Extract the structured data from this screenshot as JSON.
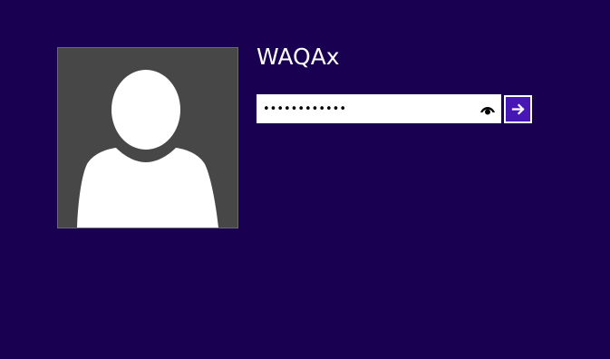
{
  "colors": {
    "background": "#1a0050",
    "avatar_tile_background": "#474747",
    "avatar_silhouette": "#ffffff",
    "username_text": "#ffffff",
    "password_field_background": "#ffffff",
    "submit_button_background": "#4617b4",
    "submit_arrow": "#ffffff",
    "reveal_icon": "#000000"
  },
  "user": {
    "name": "WAQAx",
    "avatar_icon": "default-user-silhouette-icon"
  },
  "password": {
    "value": "••••••••••••",
    "reveal_icon": "eye-icon"
  },
  "submit": {
    "icon": "right-arrow-icon"
  }
}
